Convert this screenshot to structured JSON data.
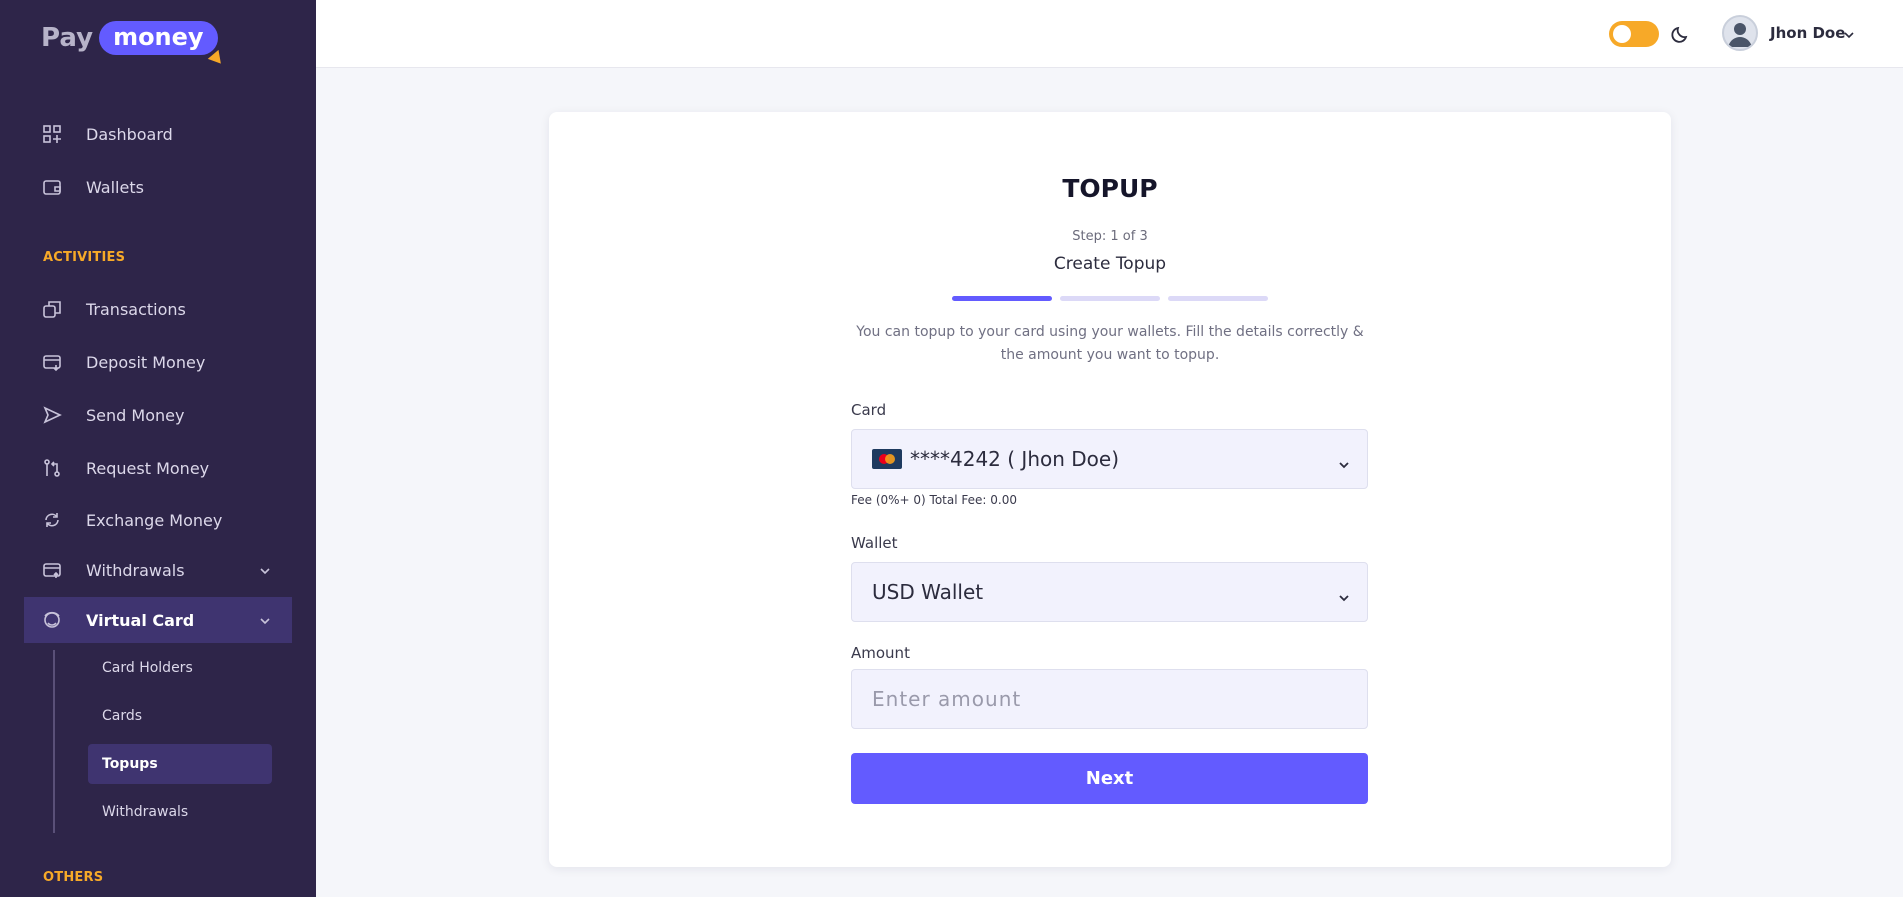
{
  "logo": {
    "pay": "Pay",
    "money": "money"
  },
  "nav": {
    "dashboard": "Dashboard",
    "wallets": "Wallets",
    "activities_label": "ACTIVITIES",
    "transactions": "Transactions",
    "deposit": "Deposit Money",
    "send": "Send Money",
    "request": "Request Money",
    "exchange": "Exchange Money",
    "withdrawals": "Withdrawals",
    "virtual_card": "Virtual Card",
    "sub": {
      "card_holders": "Card Holders",
      "cards": "Cards",
      "topups": "Topups",
      "withdrawals": "Withdrawals"
    },
    "others_label": "OTHERS"
  },
  "header": {
    "user_name": "Jhon Doe",
    "theme_toggle_on": true
  },
  "form": {
    "title": "TOPUP",
    "step": "Step: 1 of 3",
    "subtitle": "Create Topup",
    "progress_step": 1,
    "progress_total": 3,
    "description": "You can topup to your card using your wallets. Fill the details correctly & the amount you want to topup.",
    "card_label": "Card",
    "card_value": "****4242 ( Jhon Doe)",
    "fee_text": "Fee (0%+ 0) Total Fee: 0.00",
    "wallet_label": "Wallet",
    "wallet_value": "USD Wallet",
    "amount_label": "Amount",
    "amount_placeholder": "Enter amount",
    "next_label": "Next"
  },
  "colors": {
    "sidebar_bg": "#2e2549",
    "accent": "#635bff",
    "section_label": "#f7a928",
    "toggle": "#f7a928"
  }
}
